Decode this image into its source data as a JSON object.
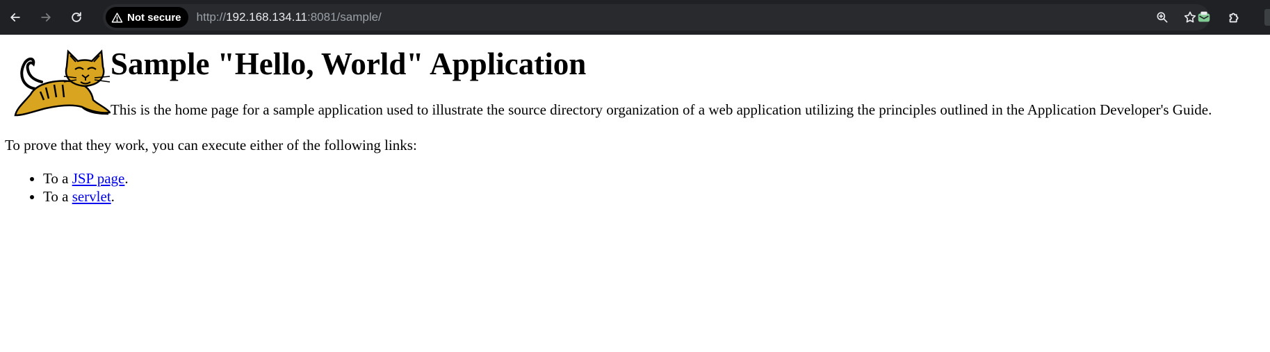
{
  "browser": {
    "security_label": "Not secure",
    "url_scheme": "http://",
    "url_host": "192.168.134.11",
    "url_rest": ":8081/sample/"
  },
  "page": {
    "title": "Sample \"Hello, World\" Application",
    "intro": "This is the home page for a sample application used to illustrate the source directory organization of a web application utilizing the principles outlined in the Application Developer's Guide.",
    "prove_text": "To prove that they work, you can execute either of the following links:",
    "links": [
      {
        "prefix": "To a ",
        "label": "JSP page",
        "suffix": "."
      },
      {
        "prefix": "To a ",
        "label": "servlet",
        "suffix": "."
      }
    ]
  },
  "colors": {
    "toolbar_bg": "#202124",
    "omnibox_bg": "#282a2e",
    "link": "#0000ee",
    "tomcat_yellow": "#d9a520"
  },
  "icons": [
    "back-arrow-icon",
    "forward-arrow-icon",
    "reload-icon",
    "warning-icon",
    "zoom-icon",
    "star-icon",
    "mail-extension-icon",
    "puzzle-extension-icon",
    "tomcat-logo"
  ]
}
